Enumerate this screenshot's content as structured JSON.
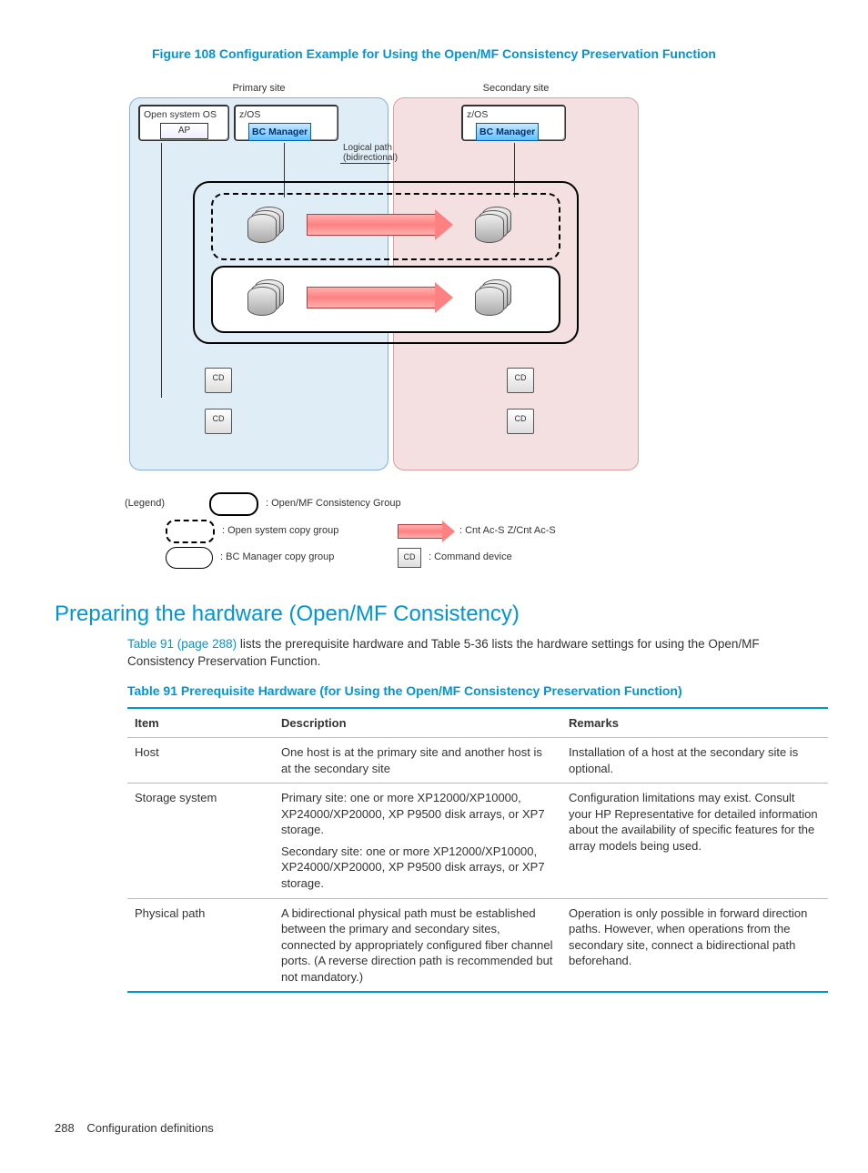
{
  "figure": {
    "caption": "Figure 108 Configuration Example for Using the Open/MF Consistency Preservation Function",
    "primary_site_label": "Primary site",
    "secondary_site_label": "Secondary site",
    "open_system_os": "Open system OS",
    "ap": "AP",
    "zos": "z/OS",
    "bc_manager": "BC Manager",
    "logical_path": "Logical path\n(bidirectional)",
    "cd": "CD",
    "legend_title": "(Legend)",
    "legend_openmf": ": Open/MF Consistency Group",
    "legend_open_copy": ": Open system copy group",
    "legend_bc_copy": ": BC Manager copy group",
    "legend_cnt": ": Cnt Ac-S Z/Cnt Ac-S",
    "legend_cmd": ": Command device"
  },
  "section_heading": "Preparing the hardware (Open/MF Consistency)",
  "para": {
    "link": "Table 91 (page 288)",
    "rest": " lists the prerequisite hardware and Table 5-36 lists the hardware settings for using the Open/MF Consistency Preservation Function."
  },
  "table": {
    "caption": "Table 91 Prerequisite Hardware (for Using the Open/MF Consistency Preservation Function)",
    "headers": {
      "item": "Item",
      "description": "Description",
      "remarks": "Remarks"
    },
    "rows": [
      {
        "item": "Host",
        "description": [
          "One host is at the primary site and another host is at the secondary site"
        ],
        "remarks": [
          "Installation of a host at the secondary site is optional."
        ]
      },
      {
        "item": "Storage system",
        "description": [
          "Primary site: one or more XP12000/XP10000, XP24000/XP20000, XP P9500 disk arrays, or XP7 storage.",
          "Secondary site: one or more XP12000/XP10000, XP24000/XP20000, XP P9500 disk arrays, or XP7 storage."
        ],
        "remarks": [
          "Configuration limitations may exist. Consult your HP Representative for detailed information about the availability of specific features for the array models being used."
        ]
      },
      {
        "item": "Physical path",
        "description": [
          "A bidirectional physical path must be established between the primary and secondary sites, connected by appropriately configured fiber channel ports. (A reverse direction path is recommended but not mandatory.)"
        ],
        "remarks": [
          "Operation is only possible in forward direction paths. However, when operations from the secondary site, connect a bidirectional path beforehand."
        ]
      }
    ]
  },
  "footer": {
    "page": "288",
    "section": "Configuration definitions"
  }
}
